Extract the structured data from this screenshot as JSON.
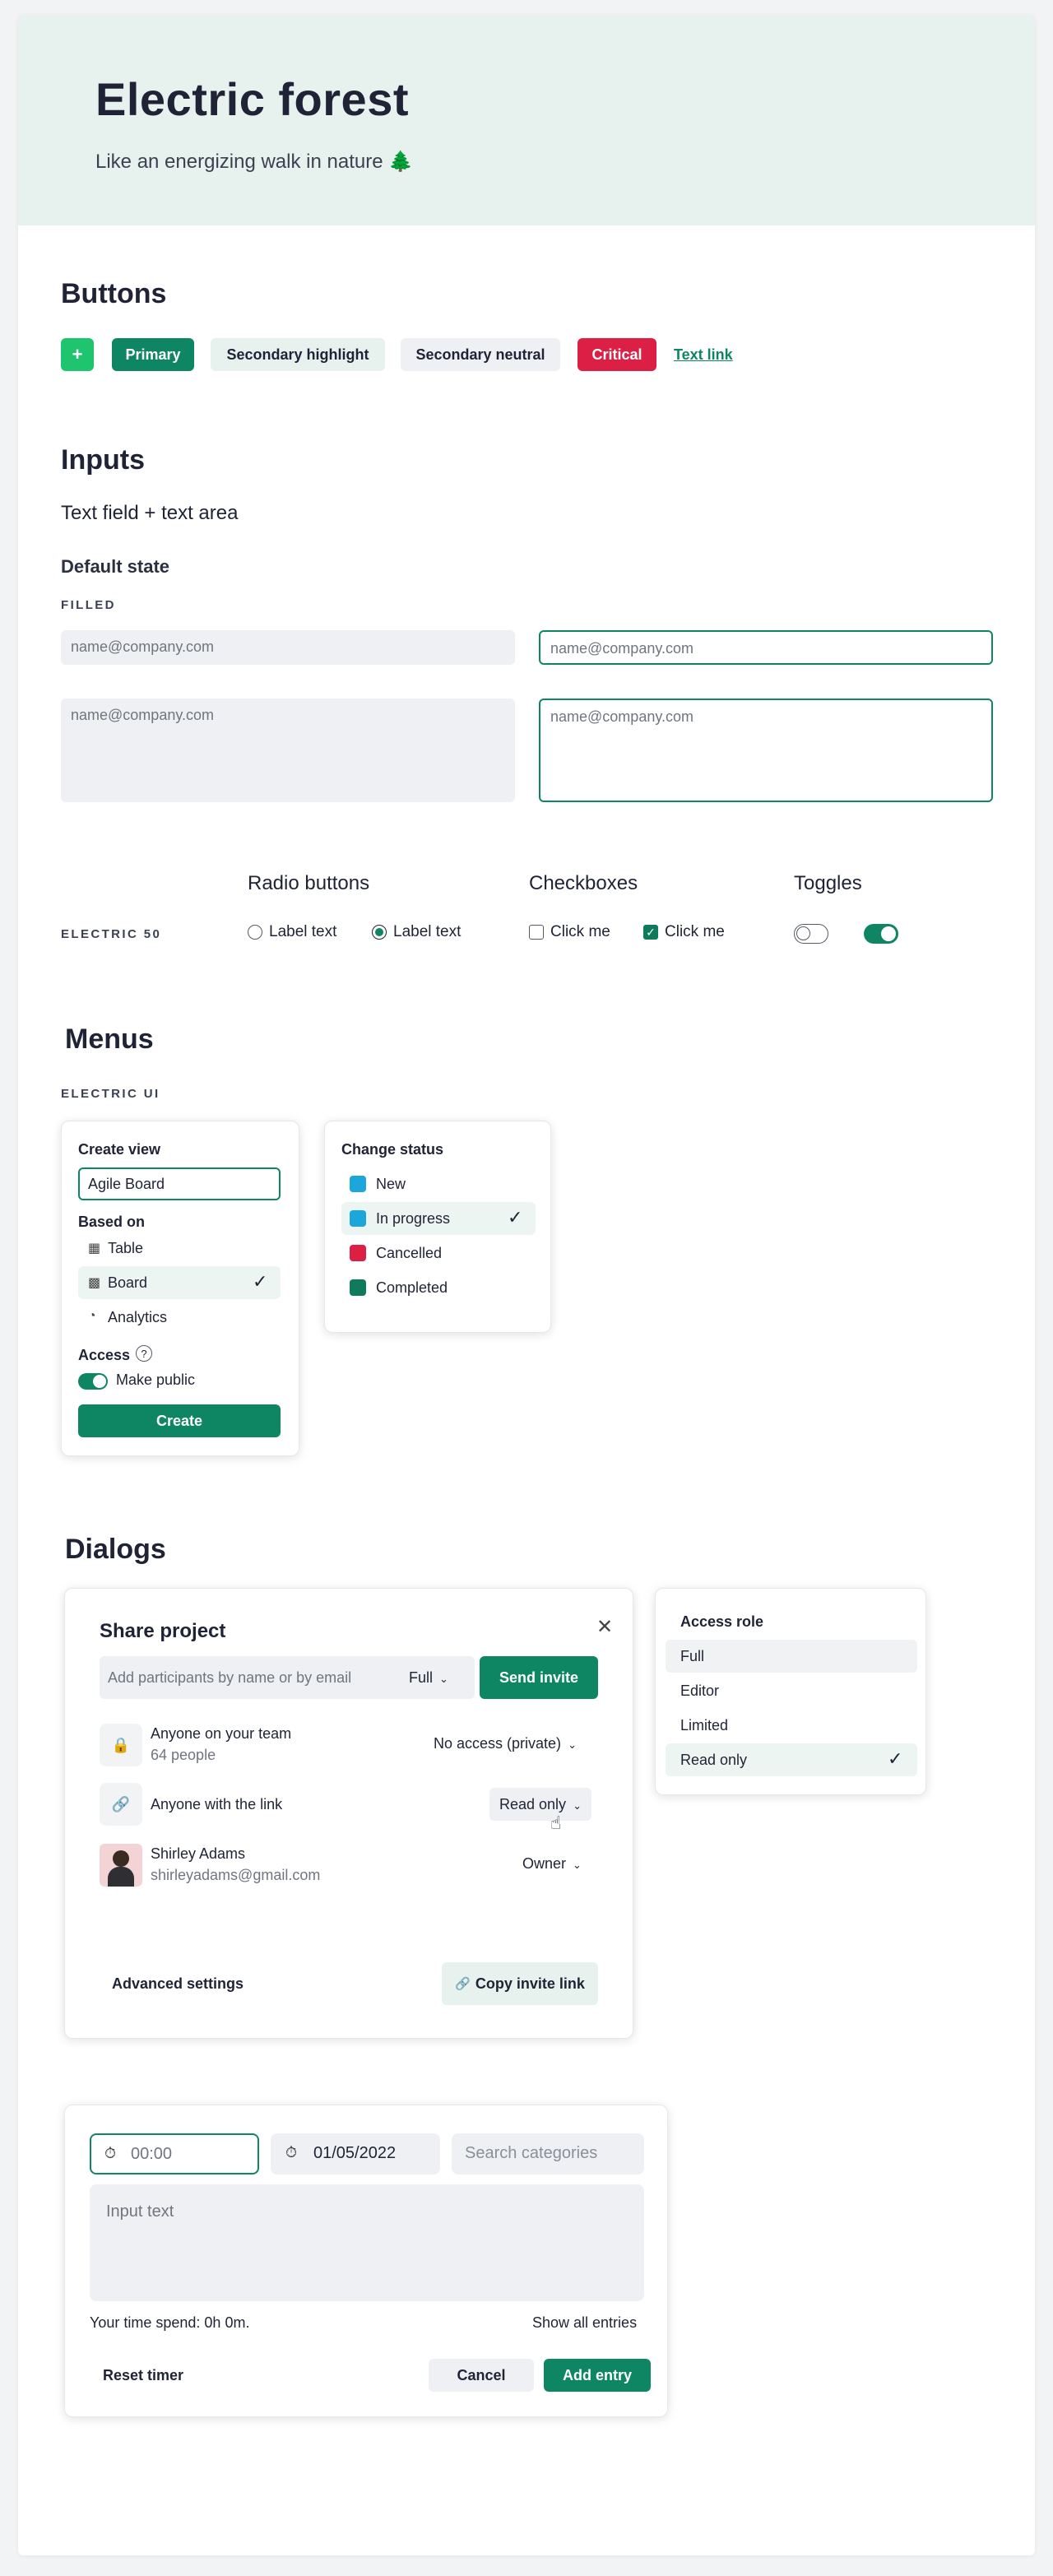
{
  "hero": {
    "title": "Electric forest",
    "subtitle": "Like an energizing walk in nature",
    "subtitle_icon": "tree-icon"
  },
  "buttons_section": {
    "title": "Buttons",
    "add_label": "+",
    "primary_label": "Primary",
    "secondary_highlight_label": "Secondary highlight",
    "secondary_neutral_label": "Secondary neutral",
    "critical_label": "Critical",
    "text_link_label": "Text link"
  },
  "inputs_section": {
    "title": "Inputs",
    "subtitle": "Text field + text area",
    "state_title": "Default state",
    "eyebrow": "FILLED",
    "placeholder": "name@company.com"
  },
  "controls": {
    "eyebrow": "ELECTRIC 50",
    "radio_title": "Radio buttons",
    "checkbox_title": "Checkboxes",
    "toggle_title": "Toggles",
    "radio_label_1": "Label text",
    "radio_label_2": "Label text",
    "checkbox_label_1": "Click me",
    "checkbox_label_2": "Click me"
  },
  "menus_section": {
    "title": "Menus",
    "eyebrow": "ELECTRIC UI",
    "create_view": {
      "title": "Create view",
      "input_value": "Agile Board",
      "based_on_label": "Based on",
      "options": [
        "Table",
        "Board",
        "Analytics"
      ],
      "access_label": "Access",
      "toggle_label": "Make public",
      "create_label": "Create"
    },
    "change_status": {
      "title": "Change status",
      "options": [
        {
          "label": "New",
          "color": "#1ba7dc"
        },
        {
          "label": "In progress",
          "color": "#1ba7dc"
        },
        {
          "label": "Cancelled",
          "color": "#dc1f45"
        },
        {
          "label": "Completed",
          "color": "#0f7a5c"
        }
      ]
    }
  },
  "dialogs_section": {
    "title": "Dialogs",
    "share": {
      "title": "Share project",
      "search_placeholder": "Add participants by name or by email",
      "permission_value": "Full",
      "send_label": "Send invite",
      "rows": [
        {
          "name": "Anyone on your team",
          "sub": "64 people",
          "access": "No access (private)"
        },
        {
          "name": "Anyone with the link",
          "sub": "",
          "access": "Read only"
        },
        {
          "name": "Shirley Adams",
          "sub": "shirleyadams@gmail.com",
          "access": "Owner"
        }
      ],
      "advanced_label": "Advanced settings",
      "copy_label": "Copy invite link"
    },
    "access_role": {
      "title": "Access role",
      "options": [
        "Full",
        "Editor",
        "Limited",
        "Read only"
      ]
    },
    "timer": {
      "time_value": "00:00",
      "date_value": "01/05/2022",
      "search_placeholder": "Search categories",
      "textarea_placeholder": "Input text",
      "time_spend": "Your time spend: 0h 0m.",
      "show_all": "Show all entries",
      "reset_label": "Reset timer",
      "cancel_label": "Cancel",
      "add_label": "Add entry"
    }
  },
  "colors": {
    "brand": "#0f8663",
    "critical": "#dc1f45",
    "accent_green": "#1fc46e",
    "hero_bg": "#e7f2ef"
  }
}
